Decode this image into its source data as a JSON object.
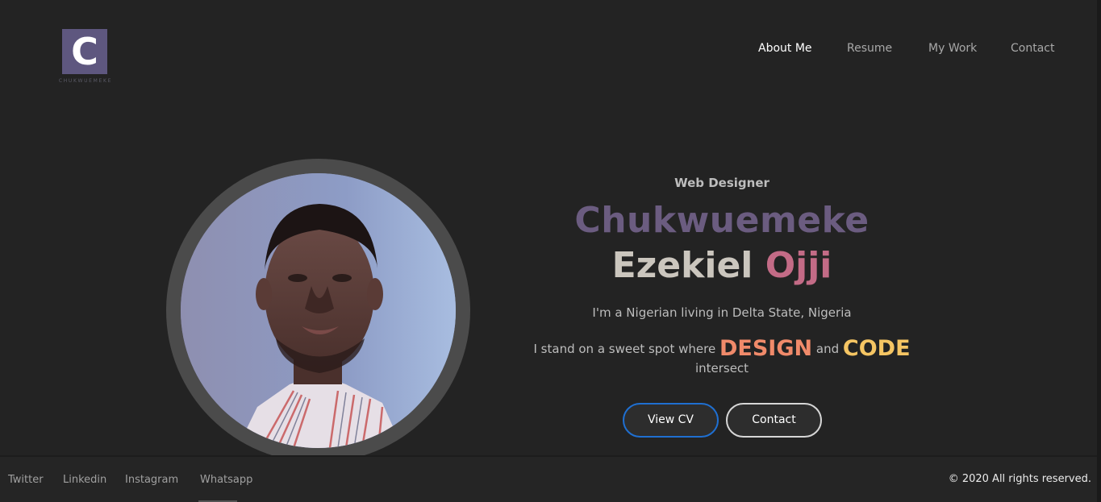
{
  "logo": {
    "letter": "C",
    "text": "CHUKWUEMEKE"
  },
  "nav": {
    "items": [
      {
        "label": "About Me",
        "active": true
      },
      {
        "label": "Resume",
        "active": false
      },
      {
        "label": "My Work",
        "active": false
      },
      {
        "label": "Contact",
        "active": false
      }
    ]
  },
  "hero": {
    "role": "Web Designer",
    "first_name": "Chukwuemeke",
    "middle_name": "Ezekiel",
    "last_name": "Ojji",
    "tagline": "I'm a Nigerian living in Delta State, Nigeria",
    "sweet_prefix": "I stand on a sweet spot where",
    "design_word": "DESIGN",
    "and_word": "and",
    "code_word": "CODE",
    "sweet_suffix": "intersect"
  },
  "buttons": {
    "cv": "View CV",
    "contact": "Contact"
  },
  "footer": {
    "social": [
      "Twitter",
      "Linkedin",
      "Instagram",
      "Whatsapp"
    ],
    "copyright": "© 2020 All rights reserved."
  },
  "colors": {
    "background": "#232323",
    "logo_bg": "#5e577f",
    "first_name": "#6b5c80",
    "last_name": "#c36b86",
    "design": "#f08a6a",
    "code": "#f5c563",
    "cv_border": "#1f6fd1"
  }
}
